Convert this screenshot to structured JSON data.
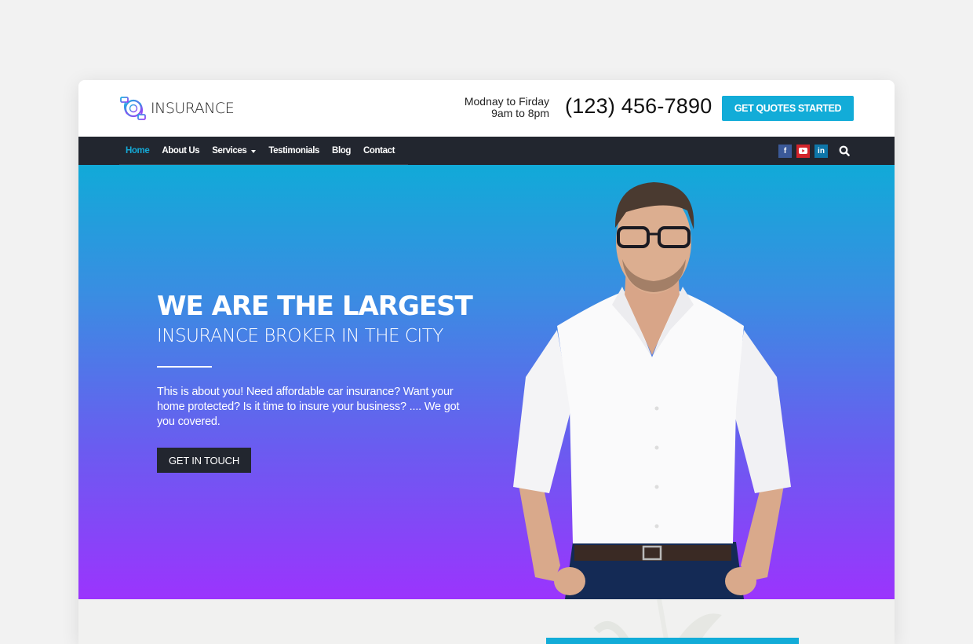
{
  "brand": {
    "logo_text": "INSURANCE",
    "accent_color": "#12acd8",
    "dark_color": "#22262f",
    "gradient_top": "#11aad8",
    "gradient_bottom": "#9b34fd"
  },
  "header": {
    "hours_line1": "Modnay to Firday",
    "hours_line2": "9am to 8pm",
    "phone": "(123) 456-7890",
    "quote_button": "GET QUOTES STARTED"
  },
  "nav": {
    "items": [
      {
        "label": "Home",
        "active": true
      },
      {
        "label": "About Us"
      },
      {
        "label": "Services",
        "has_dropdown": true
      },
      {
        "label": "Testimonials"
      },
      {
        "label": "Blog"
      },
      {
        "label": "Contact"
      }
    ],
    "social": [
      {
        "name": "facebook",
        "glyph": "f"
      },
      {
        "name": "youtube",
        "glyph": "▶"
      },
      {
        "name": "linkedin",
        "glyph": "in"
      }
    ]
  },
  "hero": {
    "title": "WE ARE THE LARGEST",
    "subtitle": "INSURANCE BROKER IN THE CITY",
    "description": "This is about you! Need affordable car insurance? Want your home protected? Is it time to insure your business? .... We got you covered.",
    "cta_label": "GET IN TOUCH",
    "image_alt": "Smiling man in white shirt and glasses"
  }
}
